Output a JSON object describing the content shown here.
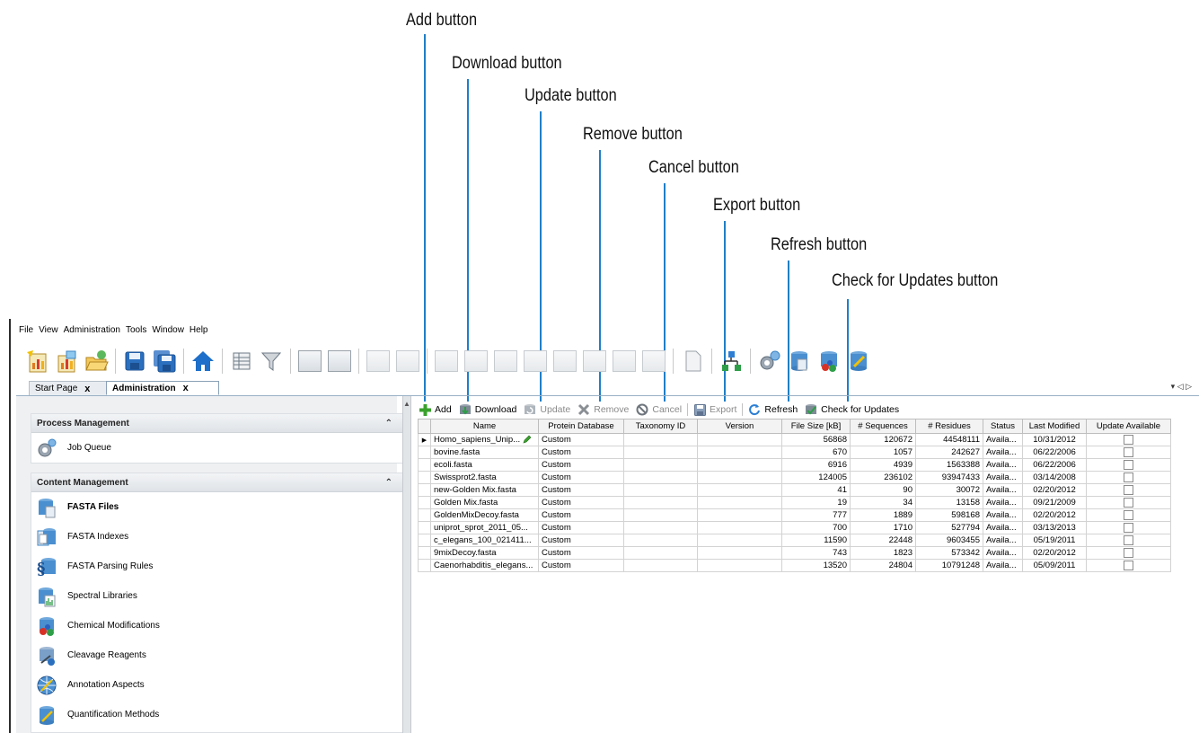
{
  "callouts": [
    {
      "id": "add",
      "label": "Add button"
    },
    {
      "id": "download",
      "label": "Download button"
    },
    {
      "id": "update",
      "label": "Update button"
    },
    {
      "id": "remove",
      "label": "Remove button"
    },
    {
      "id": "cancel",
      "label": "Cancel button"
    },
    {
      "id": "export",
      "label": "Export button"
    },
    {
      "id": "refresh",
      "label": "Refresh button"
    },
    {
      "id": "check",
      "label": "Check for Updates button"
    }
  ],
  "menu": [
    "File",
    "View",
    "Administration",
    "Tools",
    "Window",
    "Help"
  ],
  "main_toolbar_icons": [
    "report-icon",
    "report-open-icon",
    "folder-open-icon",
    "save-icon",
    "save-all-icon",
    "home-icon",
    "table-icon",
    "filter-icon",
    "spectrum-icon",
    "workflow-icon",
    "grid-view-icon",
    "preview-icon",
    "chromatogram-icon",
    "bar-chart-icon",
    "histogram-icon",
    "layout-icon",
    "identification-icon",
    "alignment-icon",
    "quant-chart-icon",
    "quant-chart2-icon",
    "document-icon",
    "tree-icon",
    "settings-icon",
    "database-icon",
    "chemistry-icon",
    "quantification-icon"
  ],
  "tabs": [
    {
      "label": "Start Page",
      "close": "x"
    },
    {
      "label": "Administration",
      "close": "x"
    }
  ],
  "tabstrip_controls": "▾ ◁ ▷",
  "left_panel": {
    "process_management": {
      "title": "Process Management",
      "collapse": "⌃",
      "items": [
        {
          "label": "Job Queue",
          "icon": "job-queue-icon"
        }
      ]
    },
    "content_management": {
      "title": "Content Management",
      "collapse": "⌃",
      "items": [
        {
          "label": "FASTA Files",
          "icon": "fasta-files-icon",
          "active": true
        },
        {
          "label": "FASTA Indexes",
          "icon": "fasta-indexes-icon"
        },
        {
          "label": "FASTA Parsing Rules",
          "icon": "parsing-rules-icon"
        },
        {
          "label": "Spectral Libraries",
          "icon": "spectral-libraries-icon"
        },
        {
          "label": "Chemical Modifications",
          "icon": "chemical-modifications-icon"
        },
        {
          "label": "Cleavage Reagents",
          "icon": "cleavage-reagents-icon"
        },
        {
          "label": "Annotation Aspects",
          "icon": "annotation-aspects-icon"
        },
        {
          "label": "Quantification Methods",
          "icon": "quantification-methods-icon"
        }
      ]
    }
  },
  "fasta_toolbar": {
    "add": "Add",
    "download": "Download",
    "update": "Update",
    "remove": "Remove",
    "cancel": "Cancel",
    "export": "Export",
    "refresh": "Refresh",
    "check": "Check for Updates"
  },
  "table": {
    "columns": [
      "Name",
      "Protein Database",
      "Taxonomy ID",
      "Version",
      "File Size [kB]",
      "# Sequences",
      "# Residues",
      "Status",
      "Last Modified",
      "Update Available"
    ],
    "rows": [
      [
        "Homo_sapiens_Unip...",
        "Custom",
        "",
        "",
        "56868",
        "120672",
        "44548111",
        "Availa...",
        "10/31/2012"
      ],
      [
        "bovine.fasta",
        "Custom",
        "",
        "",
        "670",
        "1057",
        "242627",
        "Availa...",
        "06/22/2006"
      ],
      [
        "ecoli.fasta",
        "Custom",
        "",
        "",
        "6916",
        "4939",
        "1563388",
        "Availa...",
        "06/22/2006"
      ],
      [
        "Swissprot2.fasta",
        "Custom",
        "",
        "",
        "124005",
        "236102",
        "93947433",
        "Availa...",
        "03/14/2008"
      ],
      [
        "new-Golden Mix.fasta",
        "Custom",
        "",
        "",
        "41",
        "90",
        "30072",
        "Availa...",
        "02/20/2012"
      ],
      [
        "Golden Mix.fasta",
        "Custom",
        "",
        "",
        "19",
        "34",
        "13158",
        "Availa...",
        "09/21/2009"
      ],
      [
        "GoldenMixDecoy.fasta",
        "Custom",
        "",
        "",
        "777",
        "1889",
        "598168",
        "Availa...",
        "02/20/2012"
      ],
      [
        "uniprot_sprot_2011_05...",
        "Custom",
        "",
        "",
        "700",
        "1710",
        "527794",
        "Availa...",
        "03/13/2013"
      ],
      [
        "c_elegans_100_021411...",
        "Custom",
        "",
        "",
        "11590",
        "22448",
        "9603455",
        "Availa...",
        "05/19/2011"
      ],
      [
        "9mixDecoy.fasta",
        "Custom",
        "",
        "",
        "743",
        "1823",
        "573342",
        "Availa...",
        "02/20/2012"
      ],
      [
        "Caenorhabditis_elegans...",
        "Custom",
        "",
        "",
        "13520",
        "24804",
        "10791248",
        "Availa...",
        "05/09/2011"
      ]
    ],
    "current_row_marker": "▶"
  },
  "colors": {
    "leader": "#1f7fc8",
    "add_green": "#3aa12c",
    "panel_bg": "#eef0f2"
  }
}
